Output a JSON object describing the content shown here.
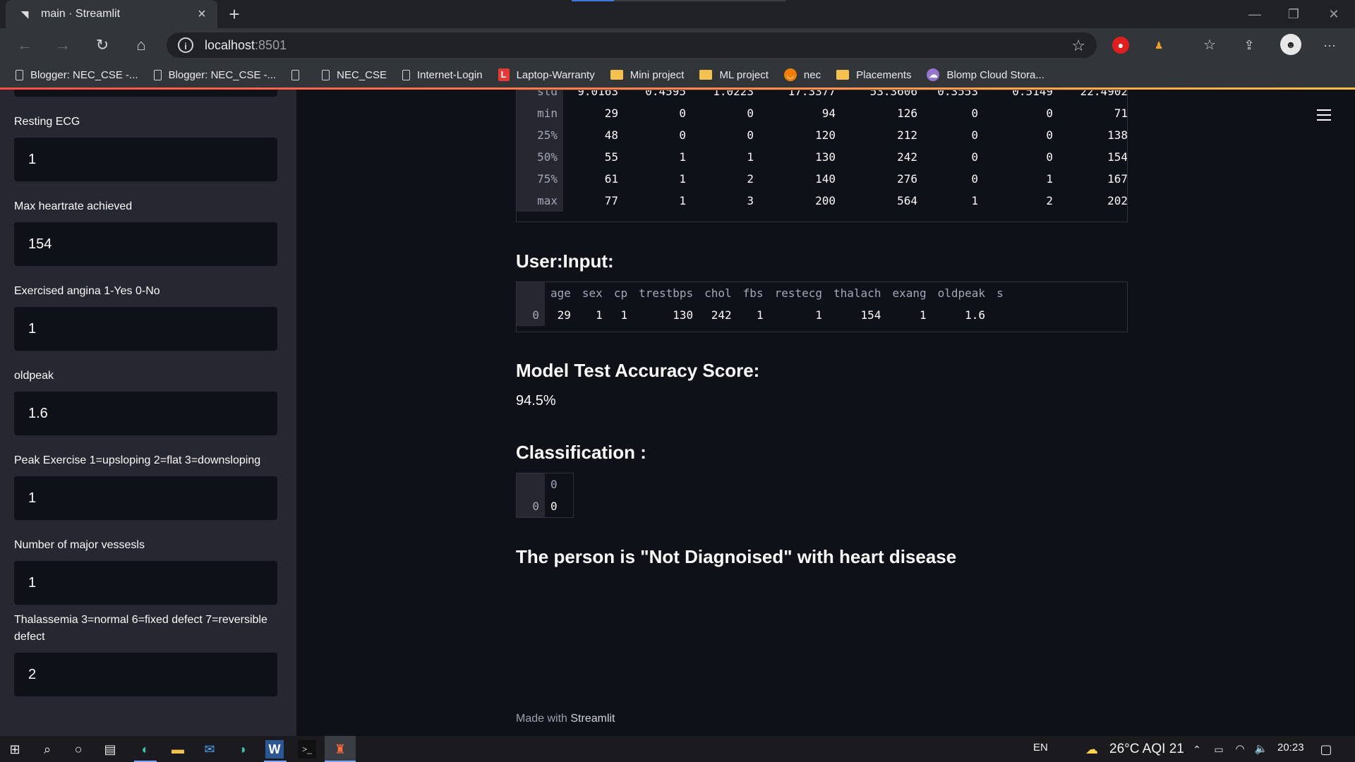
{
  "browser": {
    "tab_title": "main · Streamlit",
    "url_host": "localhost",
    "url_port": ":8501",
    "bookmarks": [
      {
        "label": "Blogger: NEC_CSE -...",
        "icon": "page-icon"
      },
      {
        "label": "Blogger: NEC_CSE -...",
        "icon": "page-icon"
      },
      {
        "label": "",
        "icon": "page-icon"
      },
      {
        "label": "NEC_CSE",
        "icon": "page-icon"
      },
      {
        "label": "Internet-Login",
        "icon": "page-icon"
      },
      {
        "label": "Laptop-Warranty",
        "icon": "red-l-icon"
      },
      {
        "label": "Mini project",
        "icon": "folder-icon"
      },
      {
        "label": "ML project",
        "icon": "folder-icon"
      },
      {
        "label": "nec",
        "icon": "orange-circle-icon"
      },
      {
        "label": "Placements",
        "icon": "folder-icon"
      },
      {
        "label": "Blomp Cloud Stora...",
        "icon": "cloud-icon"
      }
    ]
  },
  "sidebar": {
    "fields": [
      {
        "label": "Resting ECG",
        "value": "1"
      },
      {
        "label": "Max heartrate achieved",
        "value": "154"
      },
      {
        "label": "Exercised angina 1-Yes 0-No",
        "value": "1"
      },
      {
        "label": "oldpeak",
        "value": "1.6"
      },
      {
        "label": "Peak Exercise 1=upsloping 2=flat 3=downsloping",
        "value": "1"
      },
      {
        "label": "Number of major vessesls",
        "value": "1"
      },
      {
        "label": "Thalassemia 3=normal 6=fixed defect 7=reversible defect",
        "value": "2"
      }
    ]
  },
  "main": {
    "describe_table": {
      "rows": [
        {
          "index": "std",
          "values": [
            "9.0163",
            "0.4595",
            "1.0223",
            "17.3377",
            "53.3606",
            "0.3553",
            "0.5149",
            "22.4902"
          ]
        },
        {
          "index": "min",
          "values": [
            "29",
            "0",
            "0",
            "94",
            "126",
            "0",
            "0",
            "71"
          ]
        },
        {
          "index": "25%",
          "values": [
            "48",
            "0",
            "0",
            "120",
            "212",
            "0",
            "0",
            "138"
          ]
        },
        {
          "index": "50%",
          "values": [
            "55",
            "1",
            "1",
            "130",
            "242",
            "0",
            "0",
            "154"
          ]
        },
        {
          "index": "75%",
          "values": [
            "61",
            "1",
            "2",
            "140",
            "276",
            "0",
            "1",
            "167"
          ]
        },
        {
          "index": "max",
          "values": [
            "77",
            "1",
            "3",
            "200",
            "564",
            "1",
            "2",
            "202"
          ]
        }
      ]
    },
    "user_input_title": "User:Input:",
    "user_input_table": {
      "columns": [
        "age",
        "sex",
        "cp",
        "trestbps",
        "chol",
        "fbs",
        "restecg",
        "thalach",
        "exang",
        "oldpeak",
        "s"
      ],
      "rows": [
        {
          "index": "0",
          "values": [
            "29",
            "1",
            "1",
            "130",
            "242",
            "1",
            "1",
            "154",
            "1",
            "1.6",
            ""
          ]
        }
      ]
    },
    "accuracy_title": "Model Test Accuracy Score:",
    "accuracy_value": "94.5%",
    "classification_title": "Classification :",
    "classification_table": {
      "column": "0",
      "row_index": "0",
      "value": "0"
    },
    "result_text": "The person is \"Not Diagnoised\" with heart disease",
    "footer_prefix": "Made with ",
    "footer_brand": "Streamlit"
  },
  "taskbar": {
    "language": "EN",
    "weather": "26°C  AQI 21",
    "time": "20:23"
  }
}
